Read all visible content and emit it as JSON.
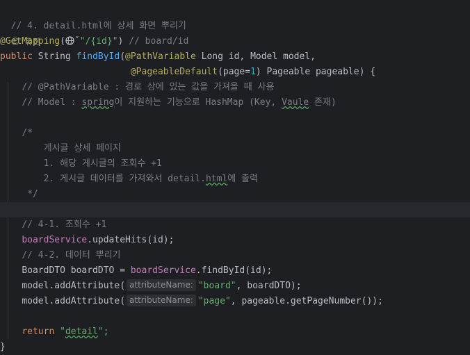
{
  "comment_top": "// 4. detail.html에 상세 화면 뿌리기",
  "author": "유진",
  "mapping": {
    "annotation": "@GetMapping",
    "path": "\"/{id}\"",
    "comment": "// board/id"
  },
  "sig1": {
    "kw": "public",
    "type": "String",
    "method": "findById",
    "ann": "@PathVariable",
    "rest": "Long id, Model model,"
  },
  "sig2": {
    "ann": "@PageableDefault",
    "param": "page",
    "num": "1",
    "rest": "Pageable pageable) {"
  },
  "c1": "// @PathVariable : 경로 상에 있는 값을 가져올 때 사용",
  "c2_pre": "// Model : ",
  "c2_word": "spring",
  "c2_post": "이 지원하는 기능으로 HashMap (Key, ",
  "c2_word2": "Vaule",
  "c2_end": " 존재)",
  "block": {
    "open": "/*",
    "l1": "게시글 상세 페이지",
    "l2": "1. 해당 게시글의 조회수 +1",
    "l3_pre": "2. 게시글 데이터를 가져와서 detail.",
    "l3_word": "html",
    "l3_post": "에 출력",
    "close": "*/"
  },
  "c3": "// 4-1. 조회수 +1",
  "call1": {
    "obj": "boardService",
    "rest": ".updateHits(id);"
  },
  "c4": "// 4-2. 데이터 뿌리기",
  "assign": {
    "lhs": "BoardDTO boardDTO = ",
    "obj": "boardService",
    "rest": ".findById(id);"
  },
  "add1": {
    "pre": "model.addAttribute(",
    "hint": "attributeName:",
    "str": "\"board\"",
    "rest": ", boardDTO);"
  },
  "add2": {
    "pre": "model.addAttribute(",
    "hint": "attributeName:",
    "str": "\"page\"",
    "rest": ", pageable.getPageNumber());"
  },
  "ret": {
    "kw": "return",
    "str_q1": "\"",
    "str": "detail",
    "str_q2": "\";"
  },
  "close": "}"
}
